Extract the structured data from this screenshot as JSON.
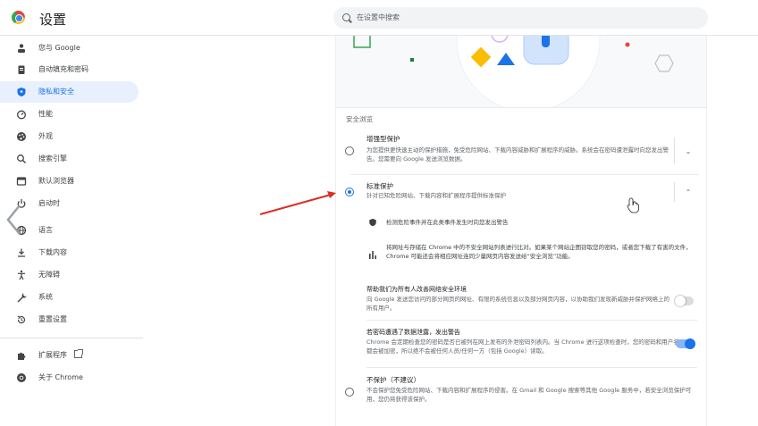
{
  "header": {
    "title": "设置",
    "search_placeholder": "在设置中搜索"
  },
  "sidebar": {
    "items": [
      {
        "label": "您与 Google",
        "icon": "person-icon"
      },
      {
        "label": "自动填充和密码",
        "icon": "clipboard-icon"
      },
      {
        "label": "隐私和安全",
        "icon": "shield-icon",
        "active": true
      },
      {
        "label": "性能",
        "icon": "speedometer-icon"
      },
      {
        "label": "外观",
        "icon": "palette-icon"
      },
      {
        "label": "搜索引擎",
        "icon": "search-icon"
      },
      {
        "label": "默认浏览器",
        "icon": "browser-icon"
      },
      {
        "label": "启动时",
        "icon": "power-icon"
      },
      {
        "label": "语言",
        "icon": "globe-icon"
      },
      {
        "label": "下载内容",
        "icon": "download-icon"
      },
      {
        "label": "无障碍",
        "icon": "accessibility-icon"
      },
      {
        "label": "系统",
        "icon": "wrench-icon"
      },
      {
        "label": "重置设置",
        "icon": "reset-icon"
      },
      {
        "label": "扩展程序",
        "icon": "puzzle-icon"
      },
      {
        "label": "关于 Chrome",
        "icon": "chrome-icon"
      }
    ]
  },
  "main": {
    "section_title": "安全浏览",
    "enhanced": {
      "title": "增强型保护",
      "desc": "为您提供更快速主动的保护措施，免受危险网站、下载内容威胁和扩展程序的威胁。系统会在密码遭泄露时向您发出警告。您需要向 Google 发送浏览数据。"
    },
    "standard": {
      "title": "标准保护",
      "desc": "针对已知危险网站、下载内容和扩展程序提供标准保护",
      "sub1": "检测危险事件并在此类事件发生时向您发出警告",
      "sub2": "将网址与存储在 Chrome 中的不安全网站列表进行比对。如果某个网站企图窃取您的密码，或者您下载了有害的文件，Chrome 可能还会将相应网址连同少量网页内容发送给“安全浏览”功能。"
    },
    "help": {
      "title": "帮助我们为所有人改善网络安全环境",
      "desc": "向 Google 发送您访问的部分网页的网址、有限的系统信息以及部分网页内容，以协助我们发现新威胁并保护网络上的所有用户。",
      "enabled": false
    },
    "password": {
      "title": "若密码遭遇了数据泄露，发出警告",
      "desc": "Chrome 会定期检查您的密码是否已被列在网上发布的外泄密码列表内。当 Chrome 进行这项检查时，您的密码和用户名都会被加密，所以绝不会被任何人员/任何一方（包括 Google）读取。",
      "enabled": true
    },
    "none": {
      "title": "不保护（不建议）",
      "desc": "不会保护您免受危险网站、下载内容和扩展程序的侵害。在 Gmail 和 Google 搜索等其他 Google 服务中，若安全浏览保护可用，您仍将获得该保护。"
    }
  },
  "colors": {
    "accent": "#1a73e8",
    "active_bg": "#e8f0fe",
    "arrow": "#d93025"
  }
}
